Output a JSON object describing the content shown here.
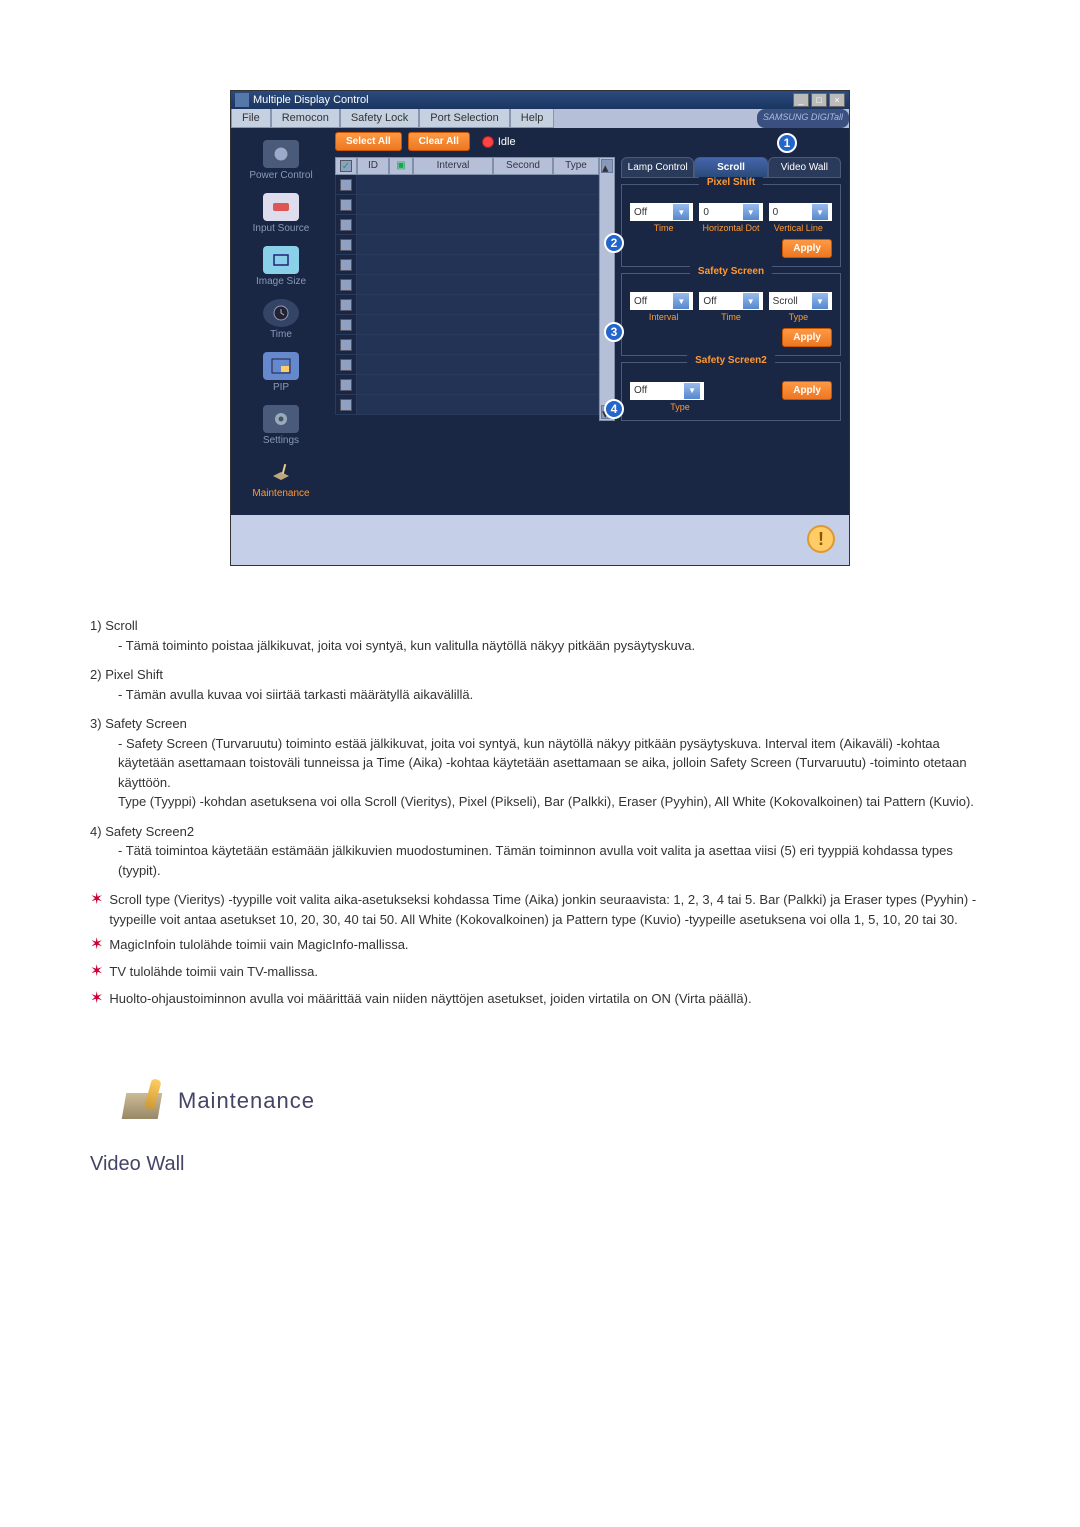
{
  "window": {
    "title": "Multiple Display Control",
    "close": "×"
  },
  "menubar": {
    "items": [
      "File",
      "Remocon",
      "Safety Lock",
      "Port Selection",
      "Help"
    ],
    "brand": "SAMSUNG DIGITall"
  },
  "sidebar": {
    "items": [
      {
        "label": "Power Control"
      },
      {
        "label": "Input Source"
      },
      {
        "label": "Image Size"
      },
      {
        "label": "Time"
      },
      {
        "label": "PIP"
      },
      {
        "label": "Settings"
      },
      {
        "label": "Maintenance"
      }
    ]
  },
  "toolbar": {
    "select_all": "Select All",
    "clear_all": "Clear All",
    "idle": "Idle"
  },
  "table": {
    "headers": {
      "id": "ID",
      "interval": "Interval",
      "second": "Second",
      "type": "Type"
    }
  },
  "tabs": {
    "lamp": "Lamp Control",
    "scroll": "Scroll",
    "video": "Video Wall"
  },
  "markers": {
    "m1": "1",
    "m2": "2",
    "m3": "3",
    "m4": "4"
  },
  "pixel_shift": {
    "title": "Pixel Shift",
    "val1": "Off",
    "val2": "0",
    "val3": "0",
    "labels": {
      "l1": "Time",
      "l2": "Horizontal Dot",
      "l3": "Vertical Line"
    },
    "apply": "Apply"
  },
  "safety_screen": {
    "title": "Safety Screen",
    "val1": "Off",
    "val2": "Off",
    "val3": "Scroll",
    "labels": {
      "l1": "Interval",
      "l2": "Time",
      "l3": "Type"
    },
    "apply": "Apply"
  },
  "safety_screen2": {
    "title": "Safety Screen2",
    "val1": "Off",
    "label": "Type",
    "apply": "Apply"
  },
  "doc": {
    "items": [
      {
        "num": "1)",
        "title": "Scroll",
        "body": "- Tämä toiminto poistaa jälkikuvat, joita voi syntyä, kun valitulla näytöllä näkyy pitkään pysäytyskuva."
      },
      {
        "num": "2)",
        "title": "Pixel Shift",
        "body": "- Tämän avulla kuvaa voi siirtää tarkasti määrätyllä aikavälillä."
      },
      {
        "num": "3)",
        "title": "Safety Screen",
        "body": "- Safety Screen (Turvaruutu) toiminto estää jälkikuvat, joita voi syntyä, kun näytöllä näkyy pitkään pysäytyskuva. Interval item (Aikaväli) -kohtaa käytetään asettamaan toistoväli tunneissa ja Time (Aika) -kohtaa käytetään asettamaan se aika, jolloin Safety Screen (Turvaruutu) -toiminto otetaan käyttöön.\nType (Tyyppi) -kohdan asetuksena voi olla Scroll (Vieritys), Pixel (Pikseli), Bar (Palkki), Eraser (Pyyhin), All White (Kokovalkoinen) tai Pattern (Kuvio)."
      },
      {
        "num": "4)",
        "title": "Safety Screen2",
        "body": "- Tätä toimintoa käytetään estämään jälkikuvien muodostuminen. Tämän toiminnon avulla voit valita ja asettaa viisi (5) eri tyyppiä kohdassa types (tyypit)."
      }
    ],
    "notes": [
      "Scroll type (Vieritys) -tyypille voit valita aika-asetukseksi kohdassa Time (Aika) jonkin seuraavista: 1, 2, 3, 4 tai 5. Bar (Palkki) ja Eraser types (Pyyhin) -tyypeille voit antaa asetukset 10, 20, 30, 40 tai 50. All White (Kokovalkoinen) ja Pattern type (Kuvio) -tyypeille asetuksena voi olla 1, 5, 10, 20 tai 30.",
      "MagicInfoin tulolähde toimii vain MagicInfo-mallissa.",
      "TV tulolähde toimii vain TV-mallissa.",
      "Huolto-ohjaustoiminnon avulla voi määrittää vain niiden näyttöjen asetukset, joiden virtatila on ON (Virta päällä)."
    ]
  },
  "section": {
    "title": "Maintenance",
    "subtitle": "Video Wall"
  }
}
